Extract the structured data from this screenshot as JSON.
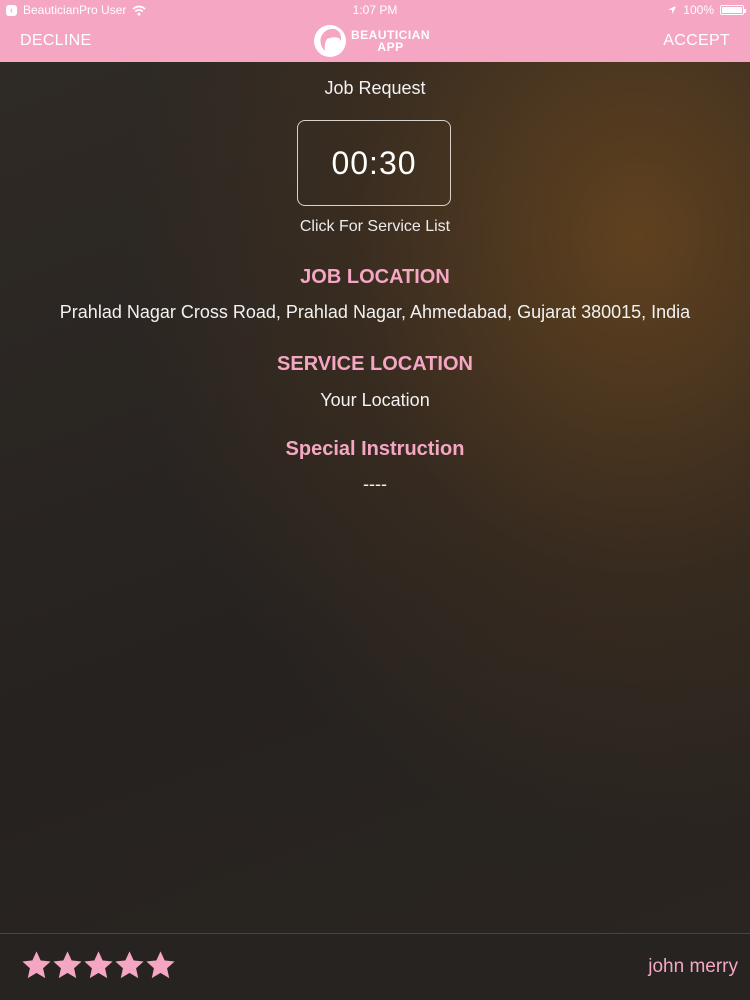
{
  "status_bar": {
    "back_app": "BeauticianPro User",
    "time": "1:07 PM",
    "battery": "100%",
    "icons": [
      "wifi-icon",
      "location-arrow-icon",
      "battery-icon"
    ]
  },
  "nav": {
    "decline_label": "DECLINE",
    "accept_label": "ACCEPT",
    "logo_line1": "BEAUTICIAN",
    "logo_line2": "APP"
  },
  "main": {
    "title": "Job Request",
    "timer": "00:30",
    "service_list_link": "Click For Service List",
    "job_location_heading": "JOB LOCATION",
    "job_location": "Prahlad Nagar Cross Road,  Prahlad Nagar,  Ahmedabad,  Gujarat 380015,  India",
    "service_location_heading": "SERVICE LOCATION",
    "service_location": "Your Location",
    "special_instruction_heading": "Special Instruction",
    "special_instruction": "----"
  },
  "footer": {
    "rating": 5,
    "rating_max": 5,
    "user_name": "john merry"
  },
  "colors": {
    "accent_pink": "#f5a6c3",
    "background_dark": "#2a2420",
    "text_light": "#f2f2f2"
  }
}
